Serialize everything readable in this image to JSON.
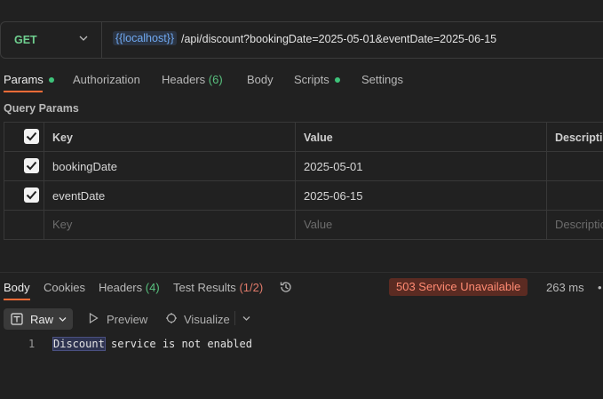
{
  "request": {
    "method": "GET",
    "url_variable": "{{localhost}}",
    "url_path": "/api/discount?bookingDate=2025-05-01&eventDate=2025-06-15"
  },
  "request_tabs": {
    "params": "Params",
    "authorization": "Authorization",
    "headers": "Headers",
    "headers_count": "(6)",
    "body": "Body",
    "scripts": "Scripts",
    "settings": "Settings"
  },
  "query_params": {
    "title": "Query Params",
    "columns": {
      "key": "Key",
      "value": "Value",
      "description": "Descriptio"
    },
    "rows": [
      {
        "key": "bookingDate",
        "value": "2025-05-01",
        "checked": true
      },
      {
        "key": "eventDate",
        "value": "2025-06-15",
        "checked": true
      }
    ],
    "placeholders": {
      "key": "Key",
      "value": "Value",
      "description": "Descriptio"
    }
  },
  "response_tabs": {
    "body": "Body",
    "cookies": "Cookies",
    "headers": "Headers",
    "headers_count": "(4)",
    "test_results": "Test Results",
    "test_results_count": "(1/2)"
  },
  "response": {
    "status": "503 Service Unavailable",
    "time": "263 ms",
    "more": "•",
    "format": "Raw",
    "preview": "Preview",
    "visualize": "Visualize",
    "line_number": "1",
    "body_highlight": "Discount",
    "body_rest": " service is not enabled"
  },
  "colors": {
    "background": "#212121",
    "method": "#6fcf8f",
    "accent": "#ff6c37",
    "status_error": "#ff8a72"
  }
}
